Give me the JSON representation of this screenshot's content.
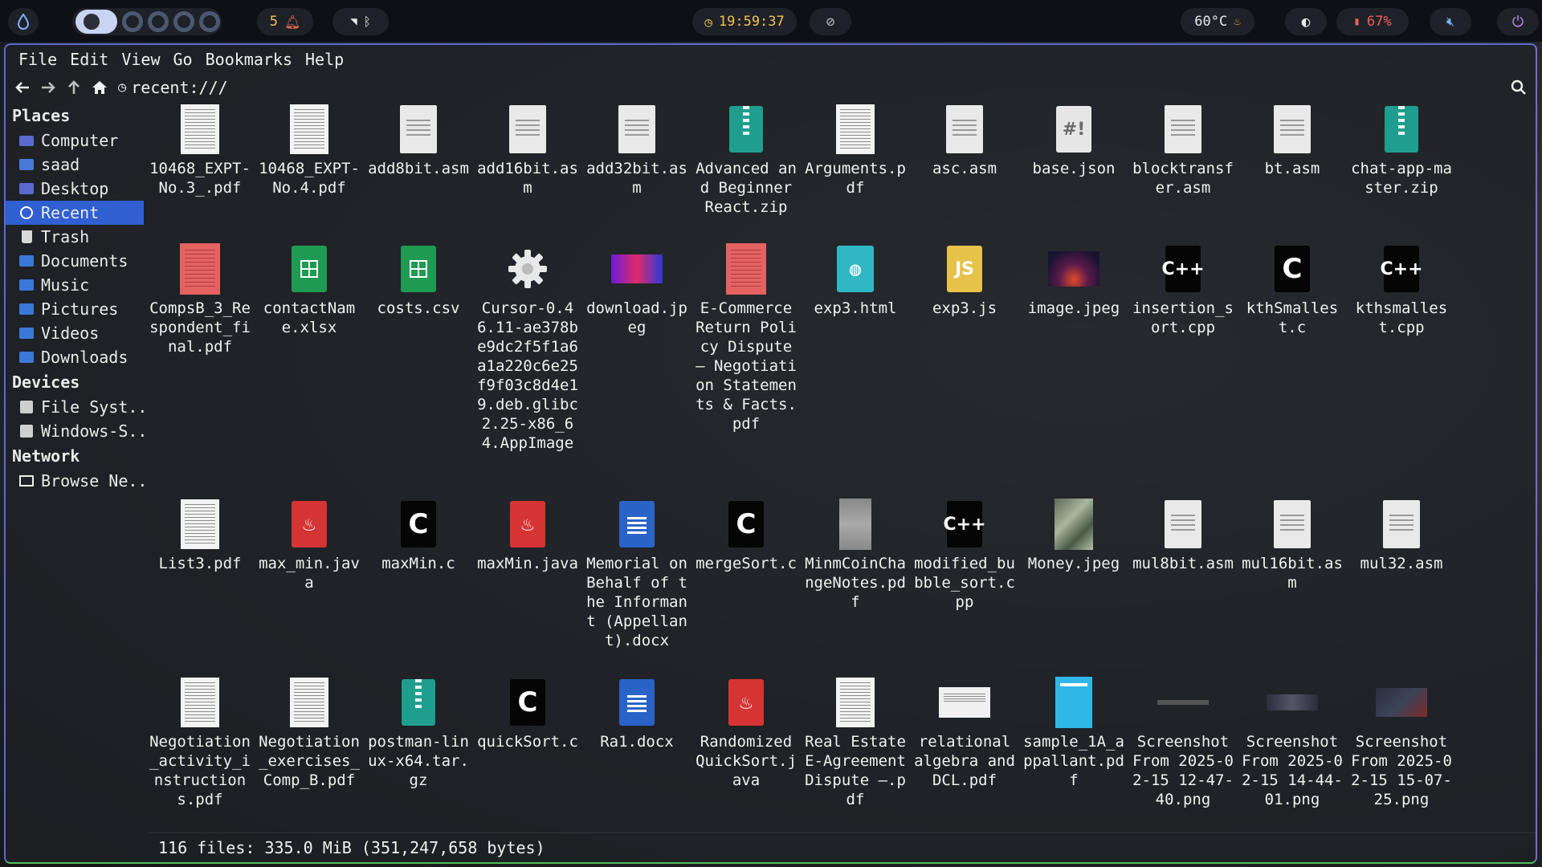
{
  "topbar": {
    "notifications": "5",
    "clock": "19:59:37",
    "temperature": "60°C",
    "battery": "67%"
  },
  "menubar": [
    "File",
    "Edit",
    "View",
    "Go",
    "Bookmarks",
    "Help"
  ],
  "location": "recent:///",
  "sidebar": {
    "places_heading": "Places",
    "places": [
      "Computer",
      "saad",
      "Desktop",
      "Recent",
      "Trash",
      "Documents",
      "Music",
      "Pictures",
      "Videos",
      "Downloads"
    ],
    "active": "Recent",
    "devices_heading": "Devices",
    "devices": [
      "File Syst...",
      "Windows-S..."
    ],
    "network_heading": "Network",
    "network": [
      "Browse Ne..."
    ]
  },
  "files": [
    {
      "name": "10468_EXPT-No.3_.pdf",
      "icon": "pdf-thumbnail"
    },
    {
      "name": "10468_EXPT-No.4.pdf",
      "icon": "pdf-thumbnail"
    },
    {
      "name": "add8bit.asm",
      "icon": "text-file-icon"
    },
    {
      "name": "add16bit.asm",
      "icon": "text-file-icon"
    },
    {
      "name": "add32bit.asm",
      "icon": "text-file-icon"
    },
    {
      "name": "Advanced and Beginner React.zip",
      "icon": "zip-icon"
    },
    {
      "name": "Arguments.pdf",
      "icon": "pdf-thumbnail"
    },
    {
      "name": "asc.asm",
      "icon": "text-file-icon"
    },
    {
      "name": "base.json",
      "icon": "json-icon"
    },
    {
      "name": "blocktransfer.asm",
      "icon": "text-file-icon"
    },
    {
      "name": "bt.asm",
      "icon": "text-file-icon"
    },
    {
      "name": "chat-app-master.zip",
      "icon": "zip-icon"
    },
    {
      "name": "CompsB_3_Respondent_final.pdf",
      "icon": "red-pdf-thumbnail"
    },
    {
      "name": "contactName.xlsx",
      "icon": "spreadsheet-icon"
    },
    {
      "name": "costs.csv",
      "icon": "spreadsheet-icon"
    },
    {
      "name": "Cursor-0.46.11-ae378be9dc2f5f1a6a1a220c6e25f9f03c8d4e19.deb.glibc2.25-x86_64.AppImage",
      "icon": "gear-icon"
    },
    {
      "name": "download.jpeg",
      "icon": "image-thumbnail-colorful"
    },
    {
      "name": "E-Commerce Return Policy Dispute – Negotiation Statements & Facts.pdf",
      "icon": "red-pdf-thumbnail"
    },
    {
      "name": "exp3.html",
      "icon": "html-icon"
    },
    {
      "name": "exp3.js",
      "icon": "js-icon"
    },
    {
      "name": "image.jpeg",
      "icon": "image-thumbnail-space"
    },
    {
      "name": "insertion_sort.cpp",
      "icon": "cpp-icon"
    },
    {
      "name": "kthSmallest.c",
      "icon": "c-icon"
    },
    {
      "name": "kthsmallest.cpp",
      "icon": "cpp-icon"
    },
    {
      "name": "List3.pdf",
      "icon": "pdf-thumbnail"
    },
    {
      "name": "max_min.java",
      "icon": "java-icon"
    },
    {
      "name": "maxMin.c",
      "icon": "c-icon"
    },
    {
      "name": "maxMin.java",
      "icon": "java-icon"
    },
    {
      "name": "Memorial on Behalf of the Informant (Appellant).docx",
      "icon": "word-icon"
    },
    {
      "name": "mergeSort.c",
      "icon": "c-icon"
    },
    {
      "name": "MinmCoinChangeNotes.pdf",
      "icon": "pdf-thumbnail-grey"
    },
    {
      "name": "modified_bubble_sort.cpp",
      "icon": "cpp-icon"
    },
    {
      "name": "Money.jpeg",
      "icon": "image-thumbnail-money"
    },
    {
      "name": "mul8bit.asm",
      "icon": "text-file-icon"
    },
    {
      "name": "mul16bit.asm",
      "icon": "text-file-icon"
    },
    {
      "name": "mul32.asm",
      "icon": "text-file-icon"
    },
    {
      "name": "Negotiation_activity_instructions.pdf",
      "icon": "pdf-thumbnail"
    },
    {
      "name": "Negotiation_exercises_Comp_B.pdf",
      "icon": "pdf-thumbnail"
    },
    {
      "name": "postman-linux-x64.tar.gz",
      "icon": "zip-icon"
    },
    {
      "name": "quickSort.c",
      "icon": "c-icon"
    },
    {
      "name": "Ra1.docx",
      "icon": "word-icon"
    },
    {
      "name": "Randomized QuickSort.java",
      "icon": "java-icon"
    },
    {
      "name": "Real Estate E-Agreement Dispute –.pdf",
      "icon": "pdf-thumbnail"
    },
    {
      "name": "relational algebra and DCL.pdf",
      "icon": "pdf-thumbnail-wide"
    },
    {
      "name": "sample_1A_appallant.pdf",
      "icon": "pdf-thumbnail-blue"
    },
    {
      "name": "Screenshot From 2025-02-15 12-47-40.png",
      "icon": "screenshot-thumbnail-1"
    },
    {
      "name": "Screenshot From 2025-02-15 14-44-01.png",
      "icon": "screenshot-thumbnail-2"
    },
    {
      "name": "Screenshot From 2025-02-15 15-07-25.png",
      "icon": "screenshot-thumbnail-3"
    }
  ],
  "status": "116 files: 335.0 MiB (351,247,658 bytes)",
  "colors": {
    "accent": "#2f5fd0",
    "window_border": "#5b6ad0",
    "topbar": "#0d1014"
  }
}
